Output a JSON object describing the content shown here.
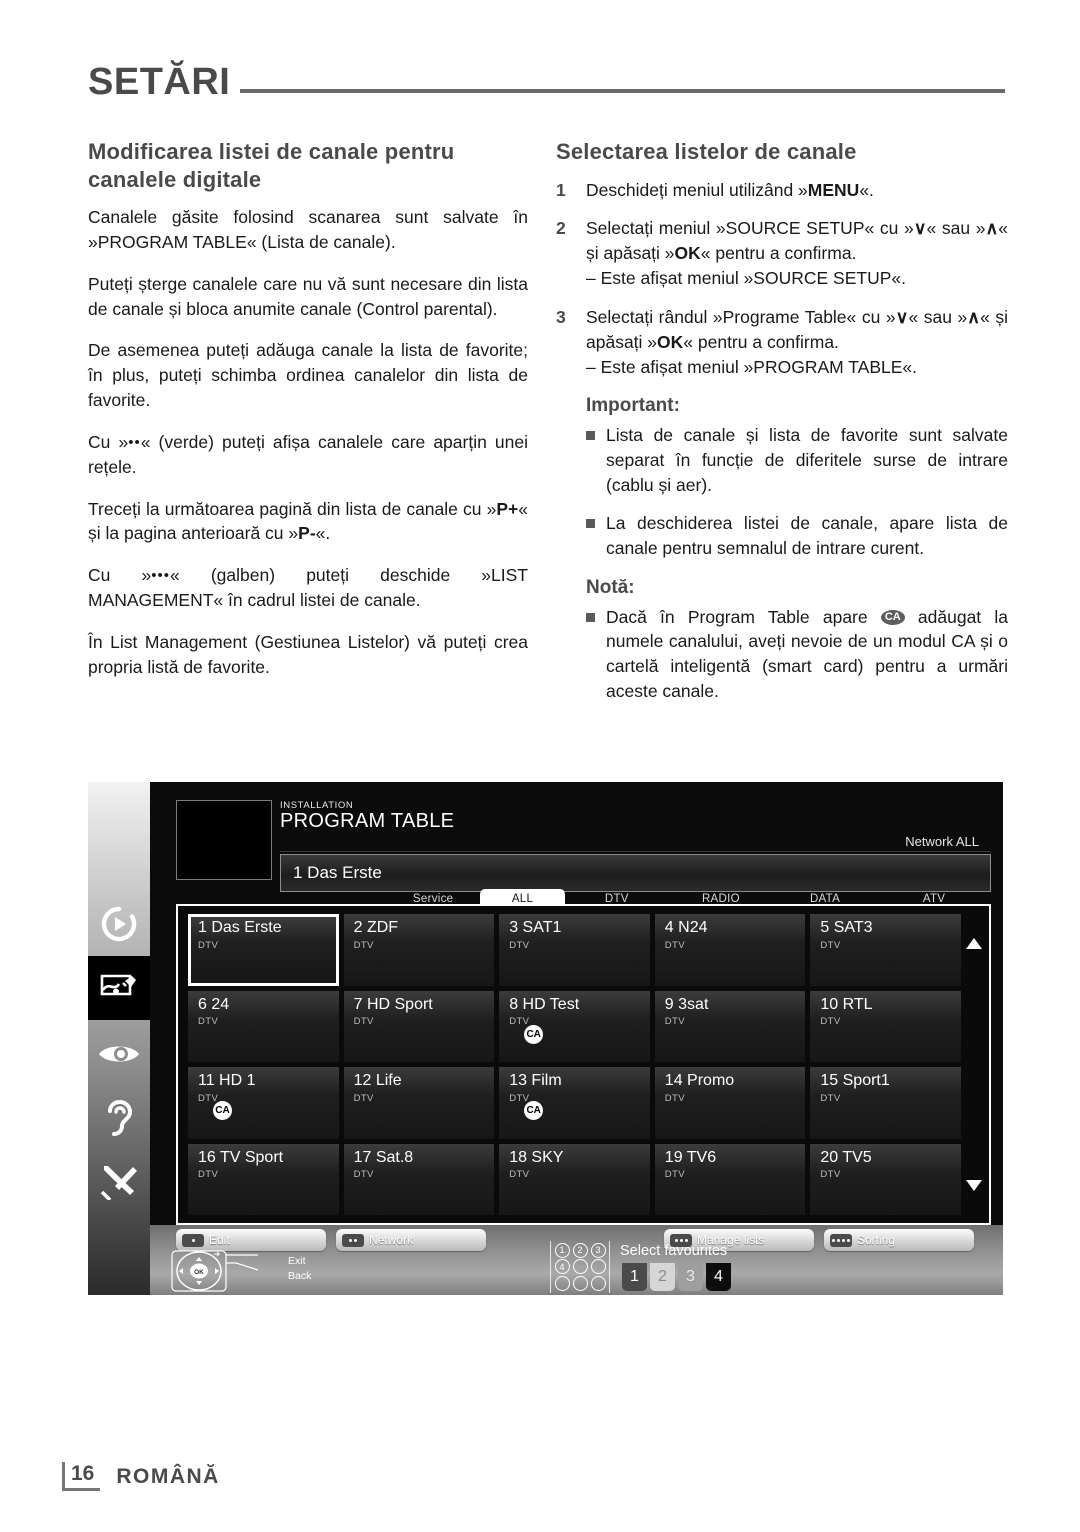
{
  "header": {
    "title": "SETĂRI"
  },
  "left_column": {
    "heading": "Modificarea listei de canale pentru canalele digitale",
    "paragraphs": [
      "Canalele găsite folosind scanarea sunt salvate în »PROGRAM TABLE« (Lista de canale).",
      "Puteți șterge canalele care nu vă sunt necesare din lista de canale și bloca anumite canale (Control parental).",
      "De asemenea puteți adăuga canale la lista de favorite; în plus, puteți schimba ordinea canalelor din lista de favorite."
    ],
    "p_green_a": "Cu »",
    "p_green_b": "« (verde) puteți afișa canalele care aparțin unei rețele.",
    "p_page_a": "Treceți la următoarea pagină din lista de canale cu »",
    "p_page_kbd1": "P+",
    "p_page_b": "« și la pagina anterioară cu »",
    "p_page_kbd2": "P-",
    "p_page_c": "«.",
    "p_yellow_a": "Cu »",
    "p_yellow_b": "« (galben) puteți deschide »LIST MANAGEMENT« în cadrul listei de canale.",
    "p_yellow_c": "În List Management (Gestiunea Listelor) vă puteți crea propria listă de favorite."
  },
  "right_column": {
    "heading": "Selectarea listelor de canale",
    "steps": [
      {
        "num": "1",
        "text_a": "Deschideți meniul utilizând »",
        "kbd": "MENU",
        "text_b": "«.",
        "sub": ""
      },
      {
        "num": "2",
        "text_a": "Selectați meniul »SOURCE SETUP« cu »",
        "kbd": "∨",
        "text_b": "« sau »",
        "kbd2": "∧",
        "text_c": "« și apăsați »",
        "kbd3": "OK",
        "text_d": "« pentru a confirma.",
        "sub": "– Este afișat meniul »SOURCE SETUP«."
      },
      {
        "num": "3",
        "text_a": "Selectați rândul »Programe Table« cu »",
        "kbd": "∨",
        "text_b": "« sau »",
        "kbd2": "∧",
        "text_c": "« și apăsați »",
        "kbd3": "OK",
        "text_d": "« pentru a confirma.",
        "sub": "– Este afișat meniul »PROGRAM TABLE«."
      }
    ],
    "important_title": "Important:",
    "important_bullets": [
      "Lista de canale și lista de favorite sunt salvate separat în funcție de diferitele surse de intrare (cablu și aer).",
      "La deschiderea listei de canale, apare lista de canale pentru semnalul de intrare curent."
    ],
    "note_title": "Notă:",
    "note_bullet_a": "Dacă în Program Table apare",
    "note_ca": "CA",
    "note_bullet_b": "adăugat la numele canalului, aveți nevoie de un modul CA și o cartelă inteligentă (smart card) pentru a urmări aceste canale."
  },
  "tv_screen": {
    "sidebar_icons": [
      "media-play-icon",
      "installation-icon",
      "picture-eye-icon",
      "sound-ear-icon",
      "settings-tools-icon"
    ],
    "active_sidebar_index": 1,
    "kicker": "INSTALLATION",
    "title": "PROGRAM TABLE",
    "network": "Network ALL",
    "selected_row": "1 Das Erste",
    "tabs": [
      {
        "label": "Service",
        "selected": false
      },
      {
        "label": "ALL",
        "selected": true
      },
      {
        "label": "DTV",
        "selected": false
      },
      {
        "label": "RADIO",
        "selected": false
      },
      {
        "label": "DATA",
        "selected": false
      },
      {
        "label": "ATV",
        "selected": false
      }
    ],
    "channels": [
      {
        "name": "1 Das Erste",
        "type": "DTV",
        "ca": false,
        "selected": true
      },
      {
        "name": "2 ZDF",
        "type": "DTV",
        "ca": false,
        "selected": false
      },
      {
        "name": "3 SAT1",
        "type": "DTV",
        "ca": false,
        "selected": false
      },
      {
        "name": "4 N24",
        "type": "DTV",
        "ca": false,
        "selected": false
      },
      {
        "name": "5 SAT3",
        "type": "DTV",
        "ca": false,
        "selected": false
      },
      {
        "name": "6 24",
        "type": "DTV",
        "ca": false,
        "selected": false
      },
      {
        "name": "7 HD Sport",
        "type": "DTV",
        "ca": false,
        "selected": false
      },
      {
        "name": "8 HD Test",
        "type": "DTV",
        "ca": true,
        "selected": false
      },
      {
        "name": "9 3sat",
        "type": "DTV",
        "ca": false,
        "selected": false
      },
      {
        "name": "10 RTL",
        "type": "DTV",
        "ca": false,
        "selected": false
      },
      {
        "name": "11 HD 1",
        "type": "DTV",
        "ca": true,
        "selected": false
      },
      {
        "name": "12 Life",
        "type": "DTV",
        "ca": false,
        "selected": false
      },
      {
        "name": "13 Film",
        "type": "DTV",
        "ca": true,
        "selected": false
      },
      {
        "name": "14 Promo",
        "type": "DTV",
        "ca": false,
        "selected": false
      },
      {
        "name": "15 Sport1",
        "type": "DTV",
        "ca": false,
        "selected": false
      },
      {
        "name": "16 TV Sport",
        "type": "DTV",
        "ca": false,
        "selected": false
      },
      {
        "name": "17 Sat.8",
        "type": "DTV",
        "ca": false,
        "selected": false
      },
      {
        "name": "18 SKY",
        "type": "DTV",
        "ca": false,
        "selected": false
      },
      {
        "name": "19 TV6",
        "type": "DTV",
        "ca": false,
        "selected": false
      },
      {
        "name": "20 TV5",
        "type": "DTV",
        "ca": false,
        "selected": false
      }
    ],
    "ca_badge_label": "CA",
    "softkeys": [
      {
        "label": "Edit",
        "dots": 1
      },
      {
        "label": "Network",
        "dots": 2
      },
      {
        "label": "Manage lists",
        "dots": 3
      },
      {
        "label": "Sorting",
        "dots": 4
      }
    ],
    "nav_exit": "Exit",
    "nav_back": "Back",
    "nav_ok": "OK",
    "numpad": [
      "1",
      "2",
      "3",
      "4",
      "",
      "",
      "",
      "",
      ""
    ],
    "fav_label": "Select favourites",
    "fav_boxes": [
      {
        "label": "1",
        "state": "dark"
      },
      {
        "label": "2",
        "state": "light"
      },
      {
        "label": "3",
        "state": "mid"
      },
      {
        "label": "4",
        "state": "black"
      }
    ]
  },
  "footer": {
    "page_number": "16",
    "language": "ROMÂNĂ"
  }
}
